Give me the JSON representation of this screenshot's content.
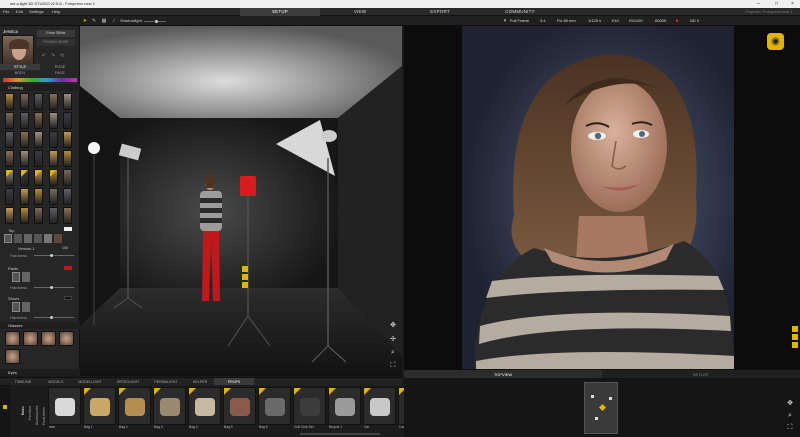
{
  "window": {
    "title": "set.a.light 3D STUDIO v2.5.8 - Fotoprenz  new 1"
  },
  "menu": [
    "File",
    "Edit",
    "Settings",
    "Help"
  ],
  "modes": [
    {
      "label": "SETUP",
      "active": true
    },
    {
      "label": "VIEW",
      "active": false
    },
    {
      "label": "EXPORT",
      "active": false
    },
    {
      "label": "COMMUNITY",
      "active": false
    }
  ],
  "project_info": "Projects › Fotoprenz  new 1",
  "toolbar": {
    "shadowlight": "Shadowlight"
  },
  "camera": {
    "format": "Full Frame",
    "ratio": "3:4",
    "lens": "Fix 85 mm",
    "shutter": "1/125 s",
    "aperture": "f/10",
    "iso": "ISO100",
    "kelvin": "6000K",
    "nd": "ND 0"
  },
  "model": {
    "name": "Jessica",
    "pose_slider": "Pose Slider",
    "posing_mode": "POSING MODE",
    "tabs": [
      "STYLE",
      "POSE",
      "BODY",
      "FACE"
    ]
  },
  "sections": {
    "clothing": "Clothing",
    "top": "Top",
    "version": "Version 1",
    "pants": "Pants",
    "shoes": "Shoes",
    "glasses": "Glasses",
    "eyes": "Eyes",
    "hardness": "Hardness",
    "hardness_value": "100"
  },
  "categories": [
    {
      "label": "TIMELINE",
      "active": false
    },
    {
      "label": "MODELS",
      "active": false
    },
    {
      "label": "MODELLIGHT",
      "active": false
    },
    {
      "label": "SPEEDLIGHT",
      "active": false
    },
    {
      "label": "PERMALIGHT",
      "active": false
    },
    {
      "label": "HELPER",
      "active": false
    },
    {
      "label": "PROPS",
      "active": true
    }
  ],
  "prop_groups": [
    "Basic",
    "Furniture",
    "Accessories",
    "Food Items"
  ],
  "props": [
    "new",
    "Bag 1",
    "Bag 2",
    "Bag 3",
    "Bag 4",
    "Bag 5",
    "Bag 6",
    "Golf Club Set",
    "Bicycle 1",
    "Car",
    "Car"
  ],
  "view_tabs": {
    "topview": "TOPVIEW",
    "setlist": "SETLIST"
  },
  "colors": {
    "accent": "#e2b400",
    "panel": "#262626",
    "active_tab": "#3d3d3d"
  }
}
